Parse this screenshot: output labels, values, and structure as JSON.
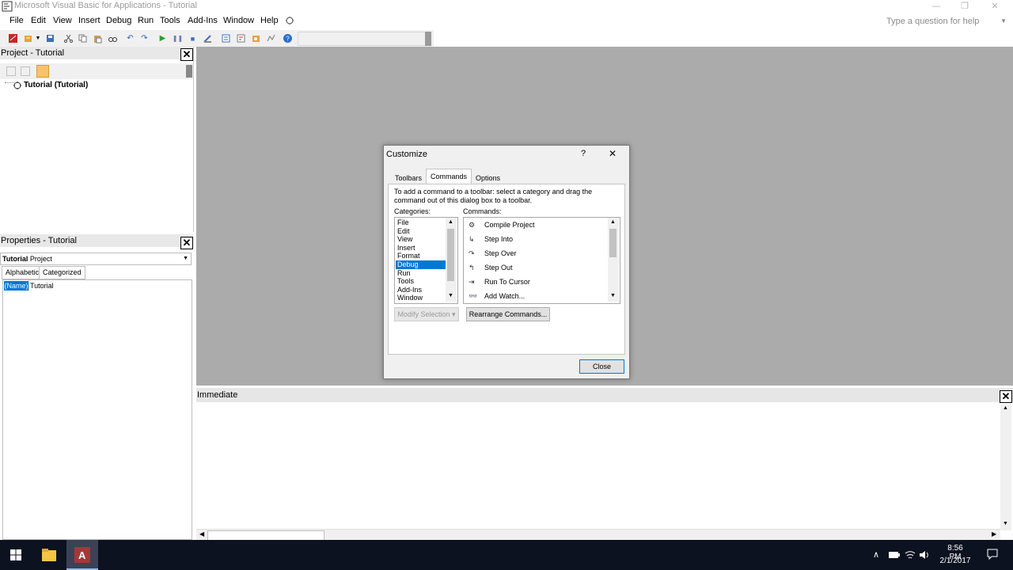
{
  "window": {
    "title": "Microsoft Visual Basic for Applications - Tutorial",
    "minimize": "—",
    "restore": "❐",
    "close": "✕"
  },
  "menu": [
    "File",
    "Edit",
    "View",
    "Insert",
    "Debug",
    "Run",
    "Tools",
    "Add-Ins",
    "Window",
    "Help"
  ],
  "help_search_placeholder": "Type a question for help",
  "project_panel": {
    "title": "Project - Tutorial",
    "tree_item": "Tutorial (Tutorial)"
  },
  "properties_panel": {
    "title": "Properties - Tutorial",
    "object_name": "Tutorial",
    "object_type": "Project",
    "tabs": [
      "Alphabetic",
      "Categorized"
    ],
    "rows": [
      {
        "name": "(Name)",
        "value": "Tutorial"
      }
    ]
  },
  "immediate": {
    "title": "Immediate"
  },
  "dialog": {
    "title": "Customize",
    "help": "?",
    "tabs": [
      "Toolbars",
      "Commands",
      "Options"
    ],
    "active_tab": "Commands",
    "instructions": "To add a command to a toolbar: select a category and drag the command out of this dialog box to a toolbar.",
    "categories_label": "Categories:",
    "commands_label": "Commands:",
    "categories": [
      "File",
      "Edit",
      "View",
      "Insert",
      "Format",
      "Debug",
      "Run",
      "Tools",
      "Add-Ins",
      "Window"
    ],
    "selected_category": "Debug",
    "commands": [
      "Compile Project",
      "Step Into",
      "Step Over",
      "Step Out",
      "Run To Cursor",
      "Add Watch..."
    ],
    "modify_selection": "Modify Selection ▾",
    "rearrange": "Rearrange Commands...",
    "close": "Close"
  },
  "taskbar": {
    "time": "8:56 PM",
    "date": "2/1/2017"
  },
  "colors": {
    "accent": "#0078d7",
    "workspace": "#ababab",
    "taskbar": "#0c1220"
  }
}
